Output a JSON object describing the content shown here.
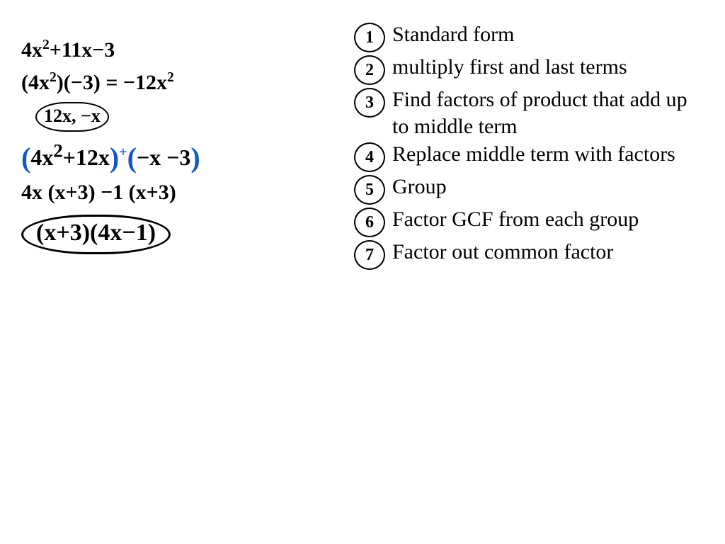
{
  "work": {
    "line1_a": "4x",
    "line1_b": "+11x−3",
    "line2_a": "(4x",
    "line2_b": ")(−3) = −12x",
    "line3": "12x, −x",
    "line4_a": "4x",
    "line4_b": "+12x",
    "line4_c": "−x −3",
    "line5": "4x (x+3) −1 (x+3)",
    "line6": "(x+3)(4x−1)"
  },
  "steps": [
    {
      "n": "1",
      "text": "Standard form"
    },
    {
      "n": "2",
      "text": "multiply first and last terms"
    },
    {
      "n": "3",
      "text": "Find factors of product that add up to middle term"
    },
    {
      "n": "4",
      "text": "Replace middle term with factors"
    },
    {
      "n": "5",
      "text": "Group"
    },
    {
      "n": "6",
      "text": "Factor GCF from each group"
    },
    {
      "n": "7",
      "text": "Factor out common factor"
    }
  ]
}
